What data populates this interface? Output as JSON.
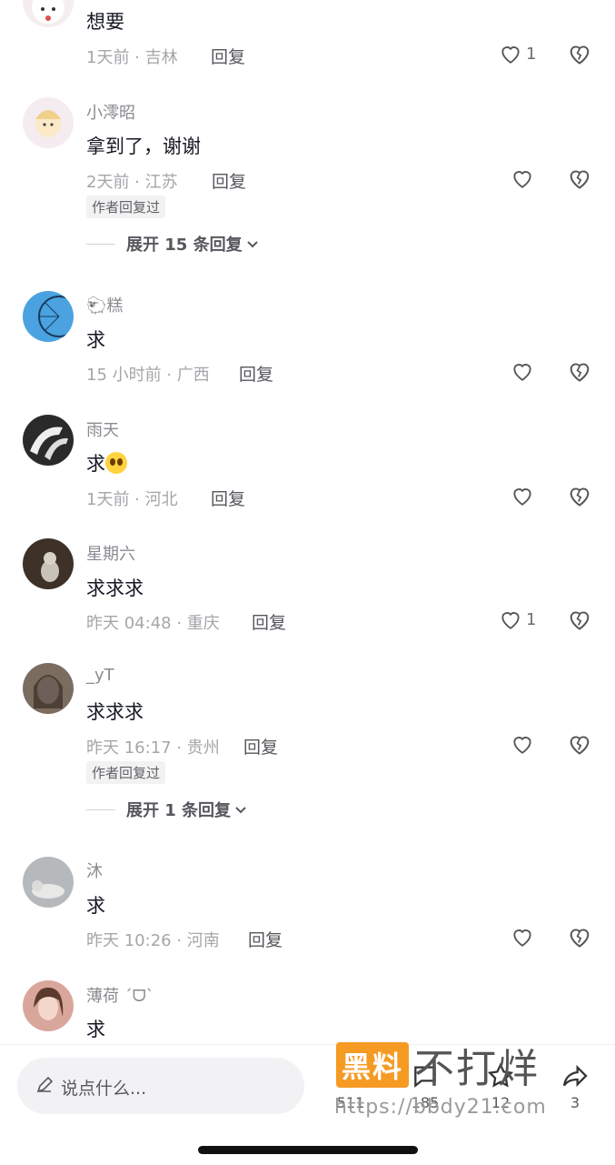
{
  "comments": [
    {
      "user": "",
      "text": "想要",
      "time": "1天前 · 吉林",
      "likes": "1",
      "author_replied": false,
      "expand": ""
    },
    {
      "user": "小澪昭",
      "text": "拿到了，谢谢",
      "time": "2天前 · 江苏",
      "likes": "",
      "author_replied": true,
      "expand": "展开 15 条回复"
    },
    {
      "user": "🐑糕",
      "text": "求",
      "time": "15 小时前 · 广西",
      "likes": "",
      "author_replied": false,
      "expand": ""
    },
    {
      "user": "雨天",
      "text": "求",
      "time": "1天前 · 河北",
      "likes": "",
      "author_replied": false,
      "expand": ""
    },
    {
      "user": "星期六",
      "text": "求求求",
      "time": "昨天 04:48 · 重庆",
      "likes": "1",
      "author_replied": false,
      "expand": ""
    },
    {
      "user": "_yT",
      "text": "求求求",
      "time": "昨天 16:17 · 贵州",
      "likes": "",
      "author_replied": true,
      "expand": "展开 1 条回复"
    },
    {
      "user": "沐",
      "text": "求",
      "time": "昨天 10:26 · 河南",
      "likes": "",
      "author_replied": false,
      "expand": ""
    },
    {
      "user": "薄荷 ˊᗜˋ",
      "text": "求",
      "time": "",
      "likes": "",
      "author_replied": false,
      "expand": ""
    }
  ],
  "labels": {
    "reply": "回复",
    "author_replied": "作者回复过"
  },
  "bottom": {
    "placeholder": "说点什么...",
    "watermark_box": "黑料",
    "watermark_text": "不打烊",
    "watermark_url": "https://bbdy21.com",
    "counts": [
      "511",
      "185",
      "12",
      "3"
    ]
  },
  "colors": {
    "avatar_bgs": [
      "#f3e6e6",
      "#efe5ec",
      "#4a9fd8",
      "#2b2b2b",
      "#5a4a3c",
      "#8b7a6c",
      "#9aa0a3",
      "#d8a8a0"
    ]
  }
}
